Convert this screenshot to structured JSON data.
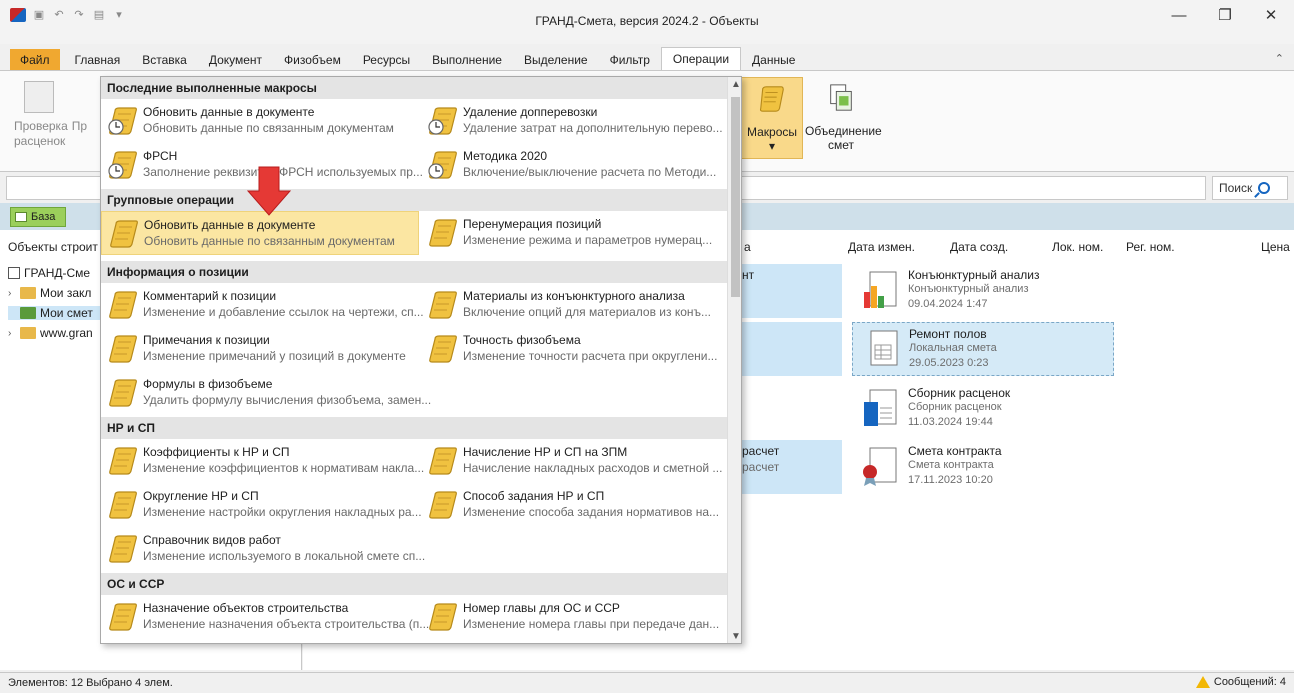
{
  "window": {
    "title": "ГРАНД-Смета, версия 2024.2 - Объекты"
  },
  "ribbon_tabs": [
    {
      "label": "Файл"
    },
    {
      "label": "Главная"
    },
    {
      "label": "Вставка"
    },
    {
      "label": "Документ"
    },
    {
      "label": "Физобъем"
    },
    {
      "label": "Ресурсы"
    },
    {
      "label": "Выполнение"
    },
    {
      "label": "Выделение"
    },
    {
      "label": "Фильтр"
    },
    {
      "label": "Операции"
    },
    {
      "label": "Данные"
    }
  ],
  "ribbon": {
    "check_label_1": "Проверка",
    "check_label_2": "расценок",
    "partial": "Пр",
    "macros_label": "Макросы",
    "macros_arrow": "▾",
    "merge_label_1": "Объединение",
    "merge_label_2": "смет"
  },
  "search": {
    "label": "Поиск"
  },
  "base_button": {
    "label": "База"
  },
  "tree": {
    "header": "Объекты строит",
    "items": [
      {
        "label": "ГРАНД-Сме"
      },
      {
        "label": "Мои закл"
      },
      {
        "label": "Мои смет"
      },
      {
        "label": "www.gran"
      }
    ]
  },
  "columns": {
    "name_partial": "а",
    "date_mod": "Дата измен.",
    "date_created": "Дата созд.",
    "loc_num": "Лок. ном.",
    "reg_num": "Рег. ном.",
    "price": "Цена"
  },
  "grid_partial": {
    "row1": "нт",
    "row4a": "расчет",
    "row4b": "расчет"
  },
  "cards": [
    {
      "title": "Конъюнктурный анализ",
      "type": "Конъюнктурный анализ",
      "date": "09.04.2024 1:47"
    },
    {
      "title": "Ремонт полов",
      "type": "Локальная смета",
      "date": "29.05.2023 0:23"
    },
    {
      "title": "Сборник расценок",
      "type": "Сборник расценок",
      "date": "11.03.2024 19:44"
    },
    {
      "title": "Смета контракта",
      "type": "Смета контракта",
      "date": "17.11.2023 10:20"
    }
  ],
  "dropdown": {
    "sections": [
      {
        "title": "Последние выполненные макросы"
      },
      {
        "title": "Групповые операции"
      },
      {
        "title": "Информация о позиции"
      },
      {
        "title": "НР и СП"
      },
      {
        "title": "ОС и ССР"
      }
    ],
    "items": [
      {
        "title": "Обновить данные в документе",
        "desc": "Обновить данные по связанным документам"
      },
      {
        "title": "Удаление допперевозки",
        "desc": "Удаление затрат на дополнительную перево..."
      },
      {
        "title": "ФРСН",
        "desc": "Заполнение реквизитов ФРСН используемых пр..."
      },
      {
        "title": "Методика 2020",
        "desc": "Включение/выключение расчета по Методи..."
      },
      {
        "title": "Обновить данные в документе",
        "desc": "Обновить данные по связанным документам"
      },
      {
        "title": "Перенумерация позиций",
        "desc": "Изменение режима и параметров нумерац..."
      },
      {
        "title": "Комментарий к позиции",
        "desc": "Изменение и добавление ссылок на чертежи, сп..."
      },
      {
        "title": "Материалы из конъюнктурного анализа",
        "desc": "Включение опций для материалов из конъ..."
      },
      {
        "title": "Примечания к позиции",
        "desc": "Изменение примечаний у позиций в документе"
      },
      {
        "title": "Точность физобъема",
        "desc": "Изменение точности расчета при округлени..."
      },
      {
        "title": "Формулы в физобъеме",
        "desc": "Удалить формулу вычисления физобъема, замен..."
      },
      {
        "title": "Коэффициенты к НР и СП",
        "desc": "Изменение коэффициентов к нормативам накла..."
      },
      {
        "title": "Начисление НР и СП на ЗПМ",
        "desc": "Начисление накладных расходов и сметной ..."
      },
      {
        "title": "Округление НР и СП",
        "desc": "Изменение настройки округления накладных ра..."
      },
      {
        "title": "Способ задания НР и СП",
        "desc": "Изменение способа задания нормативов на..."
      },
      {
        "title": "Справочник видов работ",
        "desc": "Изменение используемого в локальной смете сп..."
      },
      {
        "title": "Назначение объектов строительства",
        "desc": "Изменение назначения объекта строительства (п..."
      },
      {
        "title": "Номер главы для ОС и ССР",
        "desc": "Изменение номера главы при передаче дан..."
      }
    ]
  },
  "status": {
    "left": "Элементов: 12 Выбрано 4 элем.",
    "right": "Сообщений: 4"
  },
  "colors": {
    "accent": "#f0a830",
    "highlight": "#fbe6a2",
    "selection": "#cde6f7",
    "arrow": "#e53935"
  }
}
